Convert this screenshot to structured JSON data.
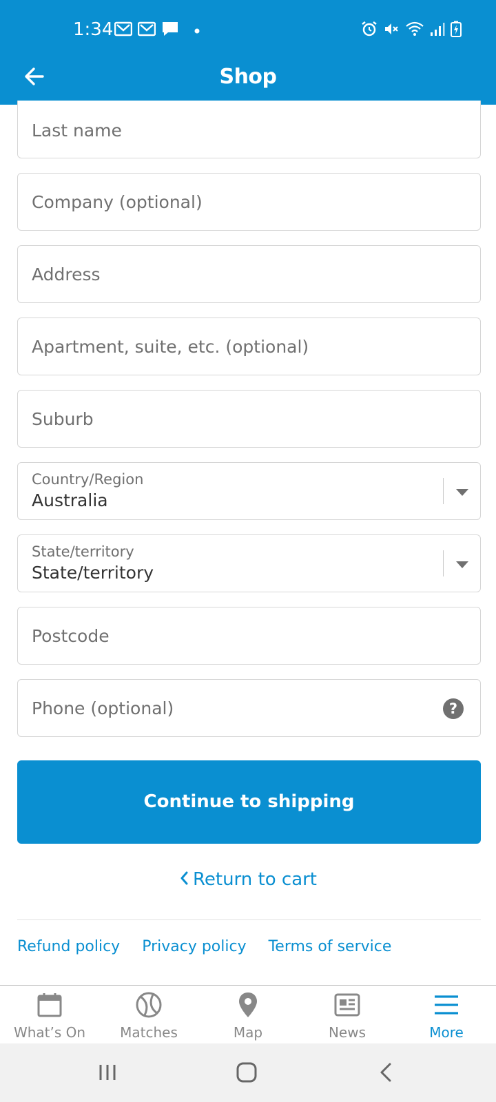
{
  "status_bar": {
    "time": "1:34"
  },
  "app_bar": {
    "title": "Shop"
  },
  "form": {
    "last_name_placeholder": "Last name",
    "company_placeholder": "Company (optional)",
    "address_placeholder": "Address",
    "apartment_placeholder": "Apartment, suite, etc. (optional)",
    "suburb_placeholder": "Suburb",
    "country": {
      "label": "Country/Region",
      "value": "Australia"
    },
    "state": {
      "label": "State/territory",
      "value": "State/territory"
    },
    "postcode_placeholder": "Postcode",
    "phone_placeholder": "Phone (optional)",
    "phone_help_glyph": "?"
  },
  "actions": {
    "continue_label": "Continue to shipping",
    "return_label": "Return to cart"
  },
  "policies": {
    "refund": "Refund policy",
    "privacy": "Privacy policy",
    "terms": "Terms of service"
  },
  "bottom_nav": {
    "items": [
      {
        "label": "What’s On",
        "icon": "calendar-icon"
      },
      {
        "label": "Matches",
        "icon": "ball-icon"
      },
      {
        "label": "Map",
        "icon": "map-pin-icon"
      },
      {
        "label": "News",
        "icon": "news-icon"
      },
      {
        "label": "More",
        "icon": "menu-icon",
        "active": true
      }
    ]
  },
  "colors": {
    "accent": "#0a8fd1",
    "border": "#d6d6d6",
    "placeholder": "#707070"
  }
}
